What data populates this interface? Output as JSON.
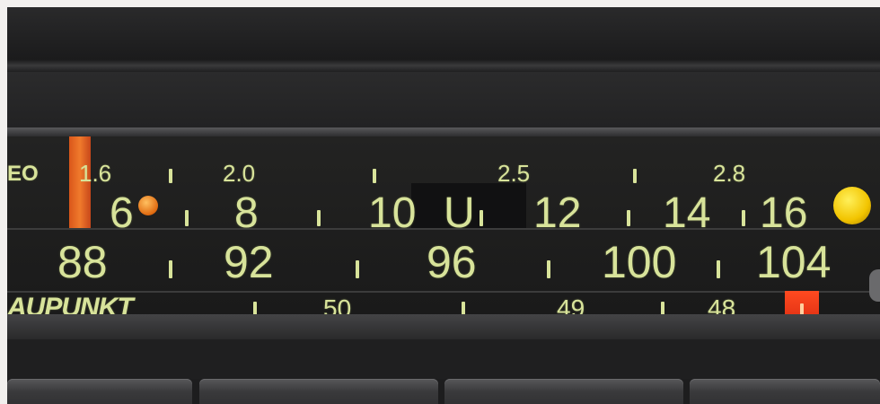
{
  "brand": {
    "text": "AUPUNKT"
  },
  "stereo_label": {
    "text": "EO"
  },
  "scales": {
    "top_mhz": [
      "1.6",
      "2.0",
      "2.5",
      "2.8"
    ],
    "lw_mw": [
      "6",
      "8",
      "10",
      "U",
      "12",
      "14",
      "16"
    ],
    "fm": [
      "88",
      "92",
      "96",
      "100",
      "104"
    ],
    "sw_bands": [
      "50",
      "49",
      "48"
    ]
  },
  "colors": {
    "scale_text": "#d8e39a",
    "pointer": "#f07a2c",
    "indicator_lamp": "#f2c400",
    "marker": "#ff4a20"
  }
}
